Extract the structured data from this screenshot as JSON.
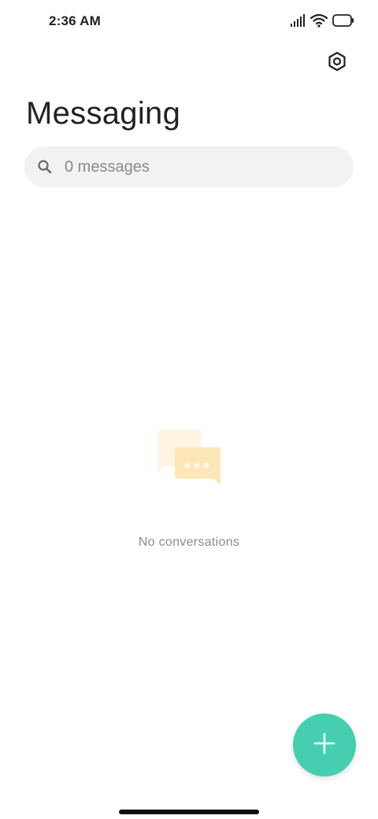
{
  "status_bar": {
    "time": "2:36 AM",
    "icons": [
      "signal-icon",
      "wifi-icon",
      "battery-icon"
    ]
  },
  "header": {
    "settings_icon": "settings-hexagon-icon",
    "title": "Messaging"
  },
  "search": {
    "placeholder": "0 messages",
    "icon": "search-icon"
  },
  "empty_state": {
    "illustration": "chat-bubbles-icon",
    "message": "No conversations"
  },
  "fab": {
    "icon": "plus-icon",
    "color": "#45cfb0"
  },
  "colors": {
    "accent": "#45cfb0",
    "illustration_light": "#fdf5e2",
    "illustration_main": "#fde7b8"
  }
}
